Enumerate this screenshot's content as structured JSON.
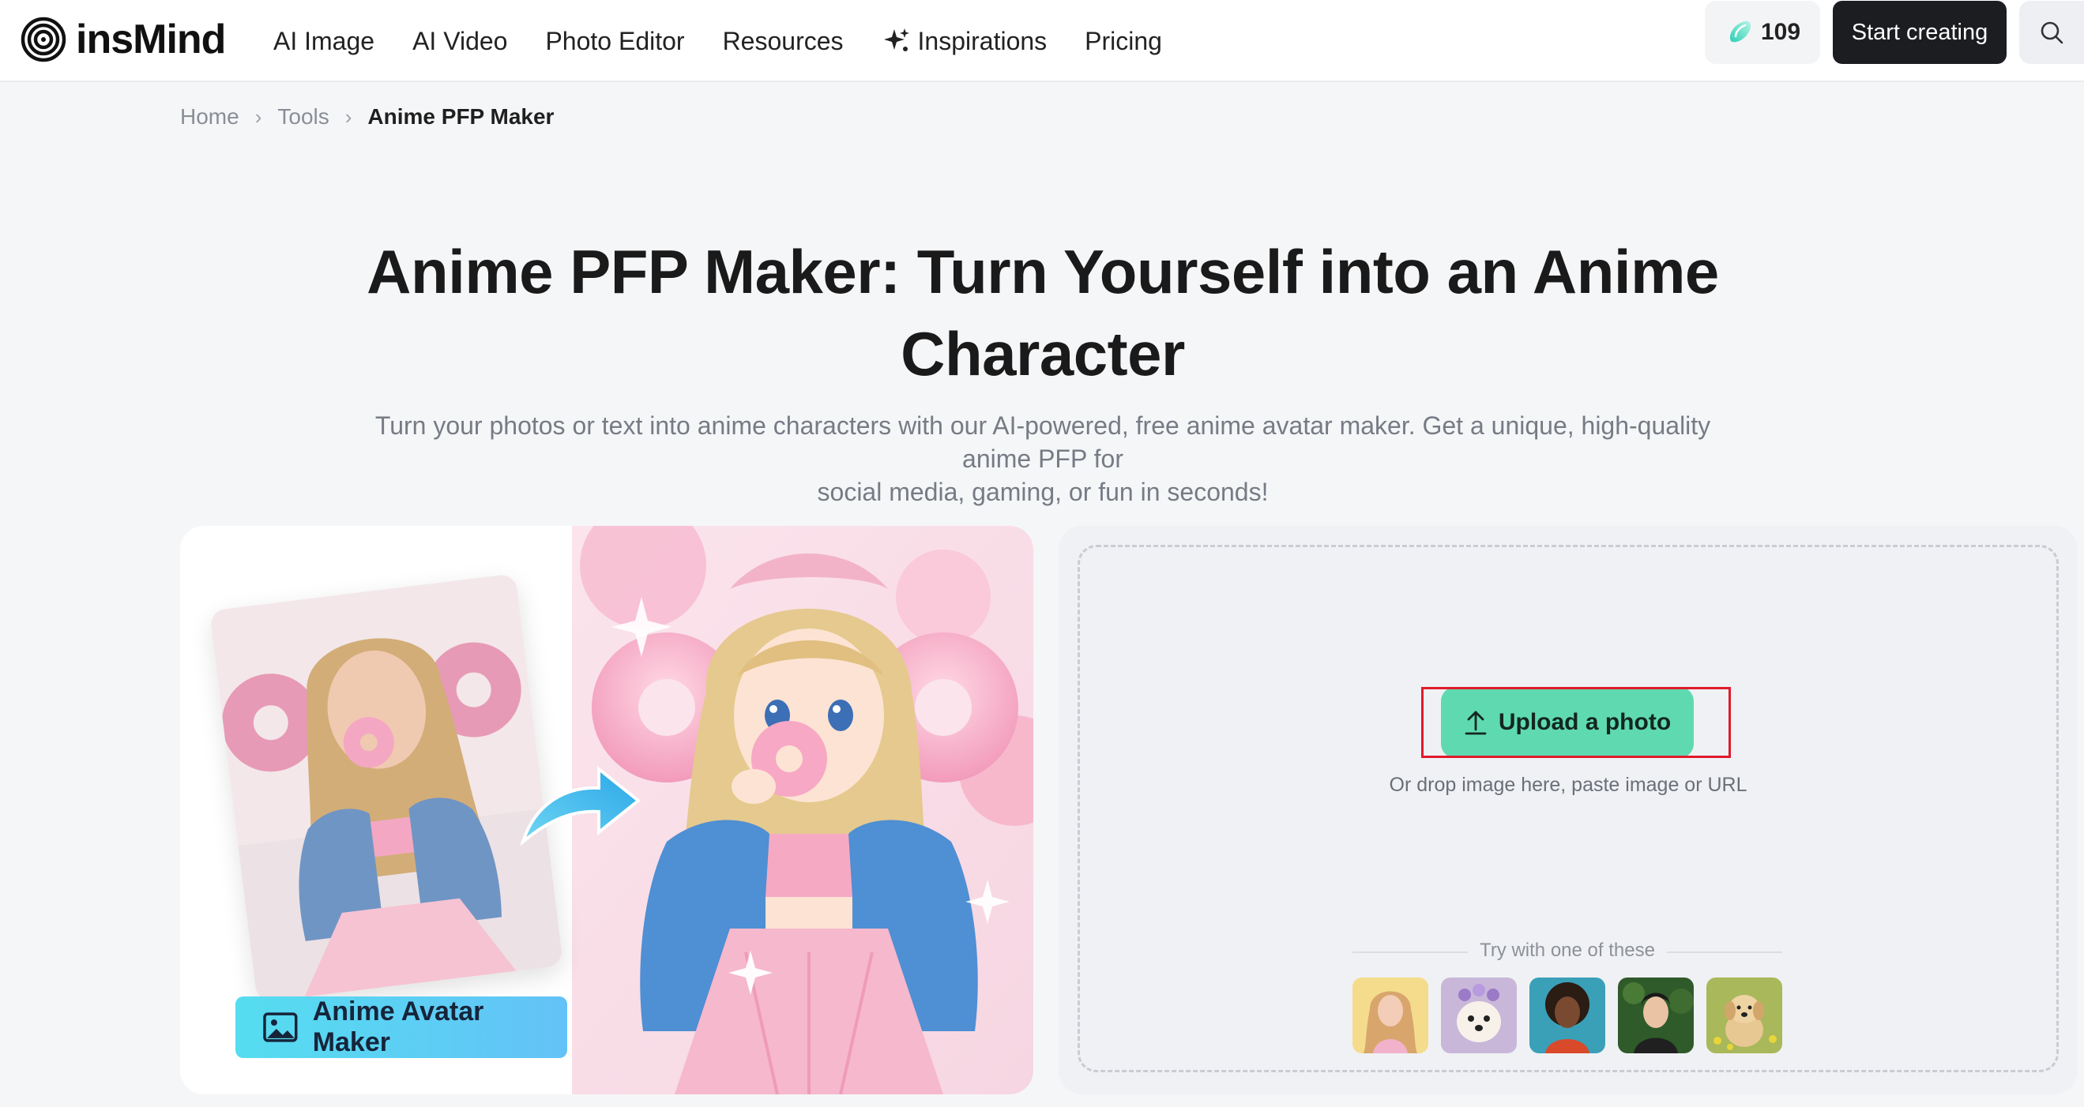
{
  "header": {
    "logo_text": "insMind",
    "nav": [
      {
        "label": "AI Image"
      },
      {
        "label": "AI Video"
      },
      {
        "label": "Photo Editor"
      },
      {
        "label": "Resources"
      },
      {
        "label": "Inspirations",
        "icon": "sparkle-icon"
      },
      {
        "label": "Pricing"
      }
    ],
    "credits": "109",
    "start_label": "Start creating"
  },
  "breadcrumb": {
    "items": [
      "Home",
      "Tools"
    ],
    "current": "Anime PFP Maker"
  },
  "hero": {
    "title_line1": "Anime PFP Maker: Turn Yourself into an Anime",
    "title_line2": "Character",
    "subtitle_line1": "Turn your photos or text into anime characters with our AI-powered, free anime avatar maker. Get a unique, high-quality anime PFP for",
    "subtitle_line2": "social media, gaming, or fun in seconds!"
  },
  "showcase": {
    "badge_label": "Anime Avatar Maker"
  },
  "upload": {
    "button_label": "Upload a photo",
    "hint": "Or drop image here, paste image or URL",
    "try_label": "Try with one of these",
    "samples": [
      {
        "name": "sample-girl-yellow"
      },
      {
        "name": "sample-dog-flowers"
      },
      {
        "name": "sample-woman-curly"
      },
      {
        "name": "sample-man-garden"
      },
      {
        "name": "sample-puppy-field"
      }
    ]
  },
  "colors": {
    "accent_green": "#5fdab0",
    "highlight_red": "#e01b2b",
    "dark_button": "#1c1d20",
    "badge_cyan": "#55ddf0"
  }
}
